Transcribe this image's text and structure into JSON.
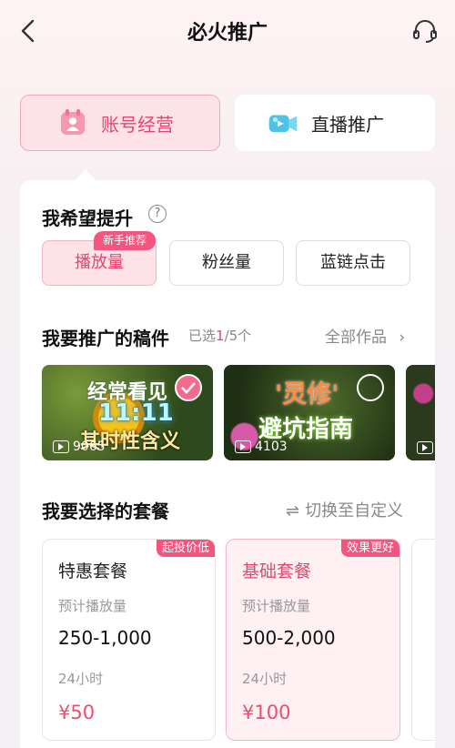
{
  "header": {
    "title": "必火推广"
  },
  "modes": [
    {
      "label": "账号经营",
      "active": true
    },
    {
      "label": "直播推广",
      "active": false
    }
  ],
  "goal_section": {
    "title": "我希望提升",
    "help": "?",
    "badge": "新手推荐",
    "options": [
      "播放量",
      "粉丝量",
      "蓝链点击"
    ]
  },
  "works_section": {
    "title": "我要推广的稿件",
    "selected_prefix": "已选",
    "selected_count": "1",
    "selected_suffix": "/5个",
    "all_label": "全部作品",
    "videos": [
      {
        "overlay_line1": "经常看见",
        "overlay_line2": "11:11",
        "overlay_line3": "其时性含义",
        "views": "9065",
        "selected": true
      },
      {
        "overlay_line1": "'灵修'",
        "overlay_line2": "避坑指南",
        "views": "4103",
        "selected": false
      }
    ]
  },
  "package_section": {
    "title": "我要选择的套餐",
    "switch_label": "切换至自定义",
    "packages": [
      {
        "badge": "起投价低",
        "name": "特惠套餐",
        "metric_label": "预计播放量",
        "range": "250-1,000",
        "duration": "24小时",
        "price": "¥50"
      },
      {
        "badge": "效果更好",
        "name": "基础套餐",
        "metric_label": "预计播放量",
        "range": "500-2,000",
        "duration": "24小时",
        "price": "¥100"
      }
    ]
  },
  "colors": {
    "accent": "#e8456c",
    "badge": "#f2557d",
    "selected_bg": "#fde2e8"
  }
}
